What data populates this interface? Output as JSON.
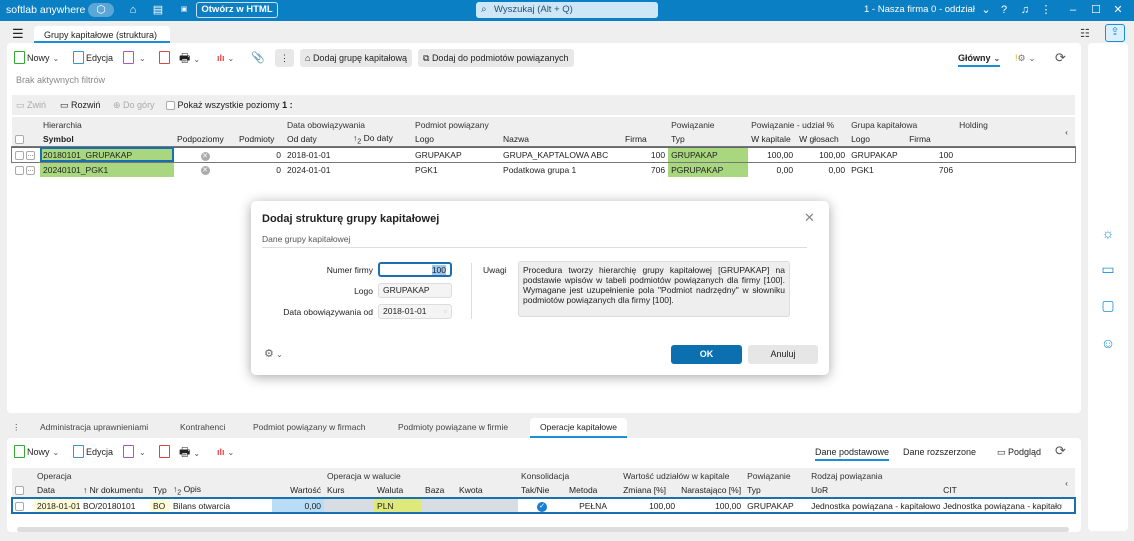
{
  "topbar": {
    "brand": "softlab anywhere",
    "open_html": "Otwórz w HTML",
    "search_placeholder": "Wyszukaj (Alt + Q)",
    "company": "1 - Nasza firma 0 - oddział"
  },
  "tabs": {
    "main": "Grupy kapitałowe (struktura)"
  },
  "toolbar": {
    "new": "Nowy",
    "edit": "Edycja",
    "add_group": "Dodaj grupę kapitałową",
    "add_to_related": "Dodaj do podmiotów powiązanych",
    "view": "Główny"
  },
  "filters": "Brak aktywnych filtrów",
  "tree_toolbar": {
    "collapse": "Zwiń",
    "expand": "Rozwiń",
    "up": "Do góry",
    "show_all": "Pokaż wszystkie poziomy",
    "level": "1 :"
  },
  "grid": {
    "groups": [
      "Hierarchia",
      "Data obowiązywania",
      "Podmiot powiązany",
      "Powiązanie",
      "Powiązanie - udział %",
      "Grupa kapitałowa",
      "Holding"
    ],
    "columns": [
      "Symbol",
      "Podpoziomy",
      "Podmioty",
      "Od daty",
      "Do daty",
      "Logo",
      "Nazwa",
      "Firma",
      "Typ",
      "W kapitale",
      "W głosach",
      "Logo",
      "Firma"
    ],
    "rows": [
      [
        "20180101_GRUPAKAP",
        "",
        "0",
        "2018-01-01",
        "",
        "GRUPAKAP",
        "GRUPA_KAPTALOWA ABC",
        "100",
        "GRUPAKAP",
        "100,00",
        "100,00",
        "GRUPAKAP",
        "100"
      ],
      [
        "20240101_PGK1",
        "",
        "0",
        "2024-01-01",
        "",
        "PGK1",
        "Podatkowa grupa 1",
        "706",
        "PGRUPAKAP",
        "0,00",
        "0,00",
        "PGK1",
        "706"
      ]
    ]
  },
  "dialog": {
    "title": "Dodaj strukturę grupy kapitałowej",
    "section": "Dane grupy kapitałowej",
    "company_label": "Numer firmy",
    "company_value": "100",
    "logo_label": "Logo",
    "logo_value": "GRUPAKAP",
    "date_label": "Data obowiązywania od",
    "date_value": "2018-01-01",
    "notes_label": "Uwagi",
    "notes": "Procedura tworzy hierarchię grupy kapitałowej [GRUPAKAP] na podstawie wpisów w tabeli podmiotów powiązanych dla firmy [100]. Wymagane jest uzupełnienie pola \"Podmiot nadrzędny\" w słowniku podmiotów powiązanych dla firmy [100].",
    "ok": "OK",
    "cancel": "Anuluj"
  },
  "bottom_tabs": [
    "Administracja uprawnieniami",
    "Kontrahenci",
    "Podmiot powiązany w firmach",
    "Podmioty powiązane w firmie",
    "Operacje kapitałowe"
  ],
  "bottom_toolbar": {
    "new": "Nowy",
    "edit": "Edycja",
    "basic": "Dane podstawowe",
    "extended": "Dane rozszerzone",
    "preview": "Podgląd"
  },
  "bgrid": {
    "groups": [
      "Operacja",
      "Operacja w walucie",
      "Konsolidacja",
      "Wartość udziałów w kapitale",
      "Powiązanie",
      "Rodzaj powiązania"
    ],
    "columns": [
      "Data",
      "Nr dokumentu",
      "Typ",
      "Opis",
      "Wartość",
      "Kurs",
      "Waluta",
      "Baza",
      "Kwota",
      "Tak/Nie",
      "Metoda",
      "Zmiana [%]",
      "Narastająco [%]",
      "Typ",
      "UoR",
      "CIT"
    ],
    "rows": [
      [
        "2018-01-01",
        "BO/20180101",
        "BO",
        "Bilans otwarcia",
        "0,00",
        "",
        "PLN",
        "",
        "",
        "",
        "PEŁNA",
        "100,00",
        "100,00",
        "GRUPAKAP",
        "Jednostka powiązana - kapitałowo",
        "Jednostka powiązana - kapitałowo"
      ]
    ]
  },
  "colors": {
    "topbar": "#0b7fc4",
    "accent": "#1a8fd8",
    "highlight_green": "#a8d77f",
    "ok_button": "#0b6fb0"
  }
}
